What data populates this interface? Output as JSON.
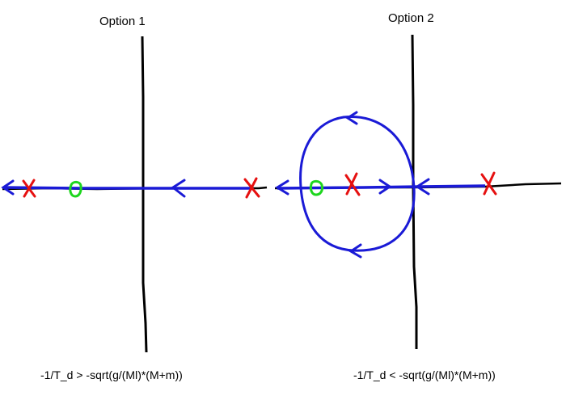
{
  "options": [
    {
      "title": "Option 1",
      "condition": "-1/T_d > -sqrt(g/(Ml)*(M+m))"
    },
    {
      "title": "Option 2",
      "condition": "-1/T_d < -sqrt(g/(Ml)*(M+m))"
    }
  ],
  "colors": {
    "axis": "#000000",
    "locus": "#1a1ad6",
    "pole": "#e61010",
    "zero": "#1ed61e"
  },
  "marker_meaning": {
    "pole": "x-mark",
    "zero": "o-mark"
  }
}
